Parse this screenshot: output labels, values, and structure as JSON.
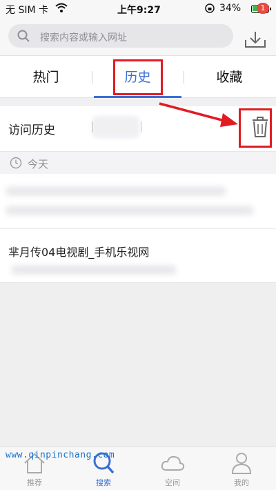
{
  "status_bar": {
    "carrier": "无 SIM 卡",
    "time": "上午9:27",
    "battery_percent": "34%",
    "battery_level": 0.34,
    "battery_color": "#2fc04a"
  },
  "search": {
    "placeholder": "搜索内容或输入网址",
    "icon": "search-icon"
  },
  "download": {
    "badge": "1",
    "icon": "download-icon",
    "badge_color": "#e94a3f"
  },
  "tabs": [
    {
      "label": "热门",
      "active": false
    },
    {
      "label": "历史",
      "active": true
    },
    {
      "label": "收藏",
      "active": false
    }
  ],
  "history_header": {
    "title": "访问历史",
    "trash_icon": "trash-icon"
  },
  "date_group": {
    "label": "今天",
    "icon": "clock-icon"
  },
  "history_items": [
    {
      "title": ""
    },
    {
      "title": "芈月传04电视剧_手机乐视网"
    }
  ],
  "bottom_nav": [
    {
      "label": "推荐",
      "icon": "home-icon",
      "active": false
    },
    {
      "label": "搜索",
      "icon": "search-icon",
      "active": true
    },
    {
      "label": "空间",
      "icon": "cloud-icon",
      "active": false
    },
    {
      "label": "我的",
      "icon": "user-icon",
      "active": false
    }
  ],
  "watermark": "www.qinpinchang.com",
  "colors": {
    "accent": "#3a6fd6",
    "annotation_red": "#e11b22"
  }
}
